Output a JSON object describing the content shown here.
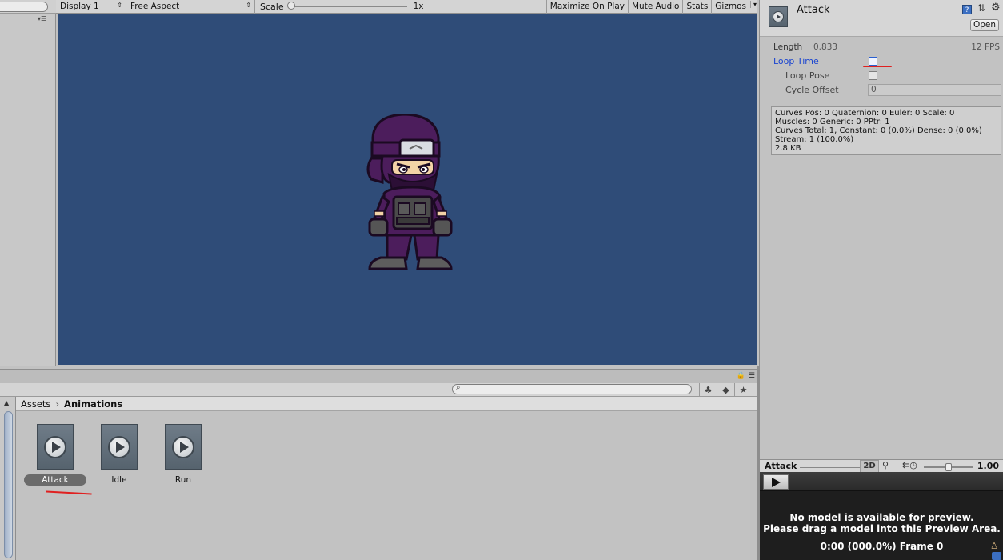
{
  "game_view": {
    "display": "Display 1",
    "aspect": "Free Aspect",
    "scale_label": "Scale",
    "scale_value": "1x",
    "maximize_on_play": "Maximize On Play",
    "mute_audio": "Mute Audio",
    "stats": "Stats",
    "gizmos": "Gizmos",
    "background_color": "#2f4c78"
  },
  "project": {
    "breadcrumb": [
      "Assets",
      "Animations"
    ],
    "assets": [
      {
        "name": "Attack",
        "selected": true
      },
      {
        "name": "Idle",
        "selected": false
      },
      {
        "name": "Run",
        "selected": false
      }
    ]
  },
  "inspector": {
    "title": "Attack",
    "open_label": "Open",
    "length_label": "Length",
    "length_value": "0.833",
    "fps": "12 FPS",
    "loop_time_label": "Loop Time",
    "loop_time_checked": false,
    "loop_pose_label": "Loop Pose",
    "loop_pose_checked": false,
    "cycle_offset_label": "Cycle Offset",
    "cycle_offset_value": "0",
    "curves_info": [
      "Curves Pos: 0 Quaternion: 0 Euler: 0 Scale: 0",
      "Muscles: 0 Generic: 0 PPtr: 1",
      "Curves Total: 1, Constant: 0 (0.0%) Dense: 0 (0.0%)",
      "Stream: 1 (100.0%)",
      "2.8 KB"
    ]
  },
  "preview": {
    "title": "Attack",
    "mode_2d": "2D",
    "speed": "1.00",
    "message_line1": "No model is available for preview.",
    "message_line2": "Please drag a model into this Preview Area.",
    "frame_info": "0:00 (000.0%) Frame 0"
  },
  "icons": {
    "play": "play-icon",
    "help": "help-icon",
    "gear": "gear-icon",
    "lock": "lock-icon",
    "search": "search-icon",
    "star": "star-icon",
    "tag": "tag-icon"
  }
}
